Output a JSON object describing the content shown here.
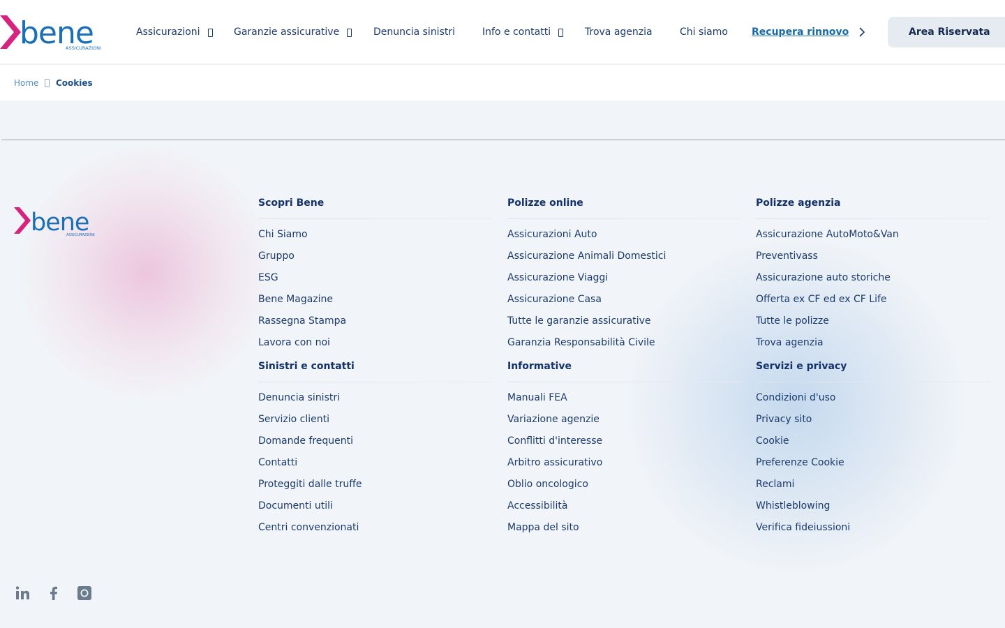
{
  "header": {
    "logo_text": "bene",
    "logo_sub": "ASSICURAZIONI",
    "nav": [
      {
        "label": "Assicurazioni",
        "dropdown": true
      },
      {
        "label": "Garanzie assicurative",
        "dropdown": true
      },
      {
        "label": "Denuncia sinistri",
        "dropdown": false
      },
      {
        "label": "Info e contatti",
        "dropdown": true
      },
      {
        "label": "Trova agenzia",
        "dropdown": false
      },
      {
        "label": "Chi siamo",
        "dropdown": false
      }
    ],
    "recupera_label": "Recupera rinnovo",
    "area_label": "Area Riservata"
  },
  "breadcrumb": {
    "home": "Home",
    "current": "Cookies"
  },
  "footer": {
    "columns": [
      {
        "title": "Scopri Bene",
        "items": [
          "Chi Siamo",
          "Gruppo",
          "ESG",
          "Bene Magazine",
          "Rassegna Stampa",
          "Lavora con noi"
        ]
      },
      {
        "title": "Polizze online",
        "items": [
          "Assicurazioni Auto",
          "Assicurazione Animali Domestici",
          "Assicurazione Viaggi",
          "Assicurazione Casa",
          "Tutte le garanzie assicurative",
          "Garanzia Responsabilità Civile"
        ]
      },
      {
        "title": "Polizze agenzia",
        "items": [
          "Assicurazione AutoMoto&Van",
          "Preventivass",
          "Assicurazione auto storiche",
          "Offerta ex CF ed ex CF Life",
          "Tutte le polizze",
          "Trova agenzia"
        ]
      },
      {
        "title": "Sinistri e contatti",
        "items": [
          "Denuncia sinistri",
          "Servizio clienti",
          "Domande frequenti",
          "Contatti",
          "Proteggiti dalle truffe",
          "Documenti utili",
          "Centri convenzionati"
        ]
      },
      {
        "title": "Informative",
        "items": [
          "Manuali FEA",
          "Variazione agenzie",
          "Conflitti d'interesse",
          "Arbitro assicurativo",
          "Oblio oncologico",
          "Accessibilità",
          "Mappa del sito"
        ]
      },
      {
        "title": "Servizi e privacy",
        "items": [
          "Condizioni d'uso",
          "Privacy sito",
          "Cookie",
          "Preferenze Cookie",
          "Reclami",
          "Whistleblowing",
          "Verifica fideiussioni"
        ]
      }
    ],
    "social": [
      "linkedin-icon",
      "facebook-icon",
      "instagram-icon"
    ]
  },
  "colors": {
    "brand_magenta": "#d6237e",
    "brand_blue": "#1b6fb8",
    "text_navy": "#1b3a6b",
    "link_blue": "#1769a8",
    "background": "#f1f4f8"
  }
}
